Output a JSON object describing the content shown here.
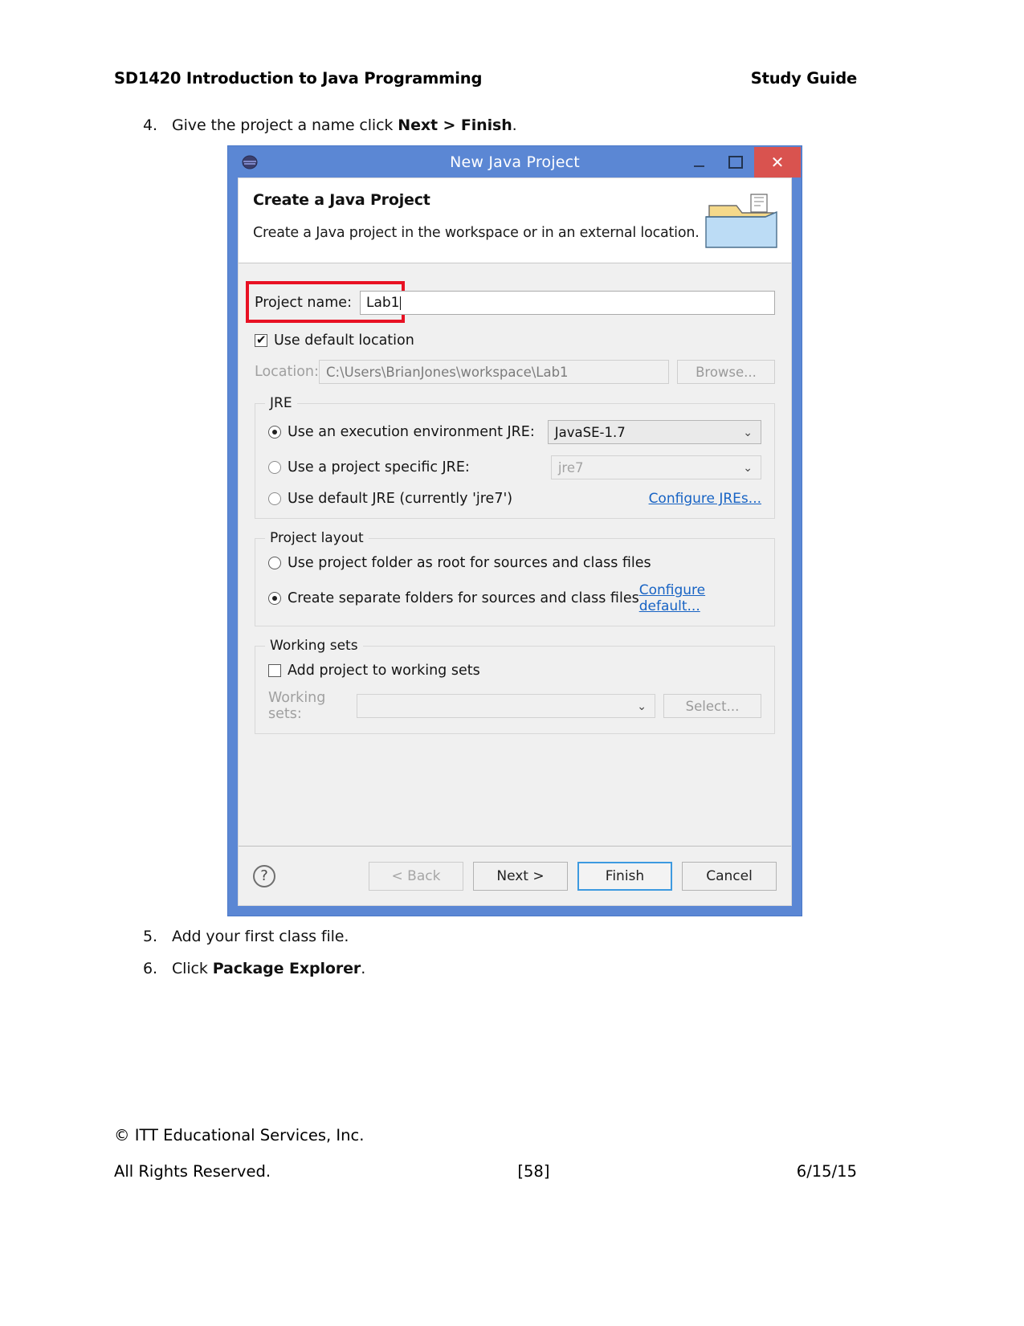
{
  "document": {
    "header_left": "SD1420 Introduction to Java Programming",
    "header_right": "Study Guide",
    "steps": [
      {
        "num": "4.",
        "pre": "Give the project a name click ",
        "bold": "Next > Finish",
        "post": "."
      },
      {
        "num": "5.",
        "pre": "Add your first class file.",
        "bold": "",
        "post": ""
      },
      {
        "num": "6.",
        "pre": "Click ",
        "bold": "Package Explorer",
        "post": "."
      }
    ],
    "footer": {
      "line1": "© ITT Educational Services, Inc.",
      "rights": "All Rights Reserved.",
      "page": "[58]",
      "date": "6/15/15"
    }
  },
  "dialog": {
    "title": "New Java Project",
    "app_icon": "eclipse-icon",
    "window_buttons": {
      "minimize": "–",
      "maximize": "▢",
      "close": "✕"
    },
    "banner": {
      "heading": "Create a Java Project",
      "subtext": "Create a Java project in the workspace or in an external location.",
      "image": "java-project-folder-icon"
    },
    "project_name": {
      "label": "Project name:",
      "value": "Lab1"
    },
    "use_default_location": {
      "label": "Use default location",
      "checked": true
    },
    "location": {
      "label": "Location:",
      "value": "C:\\Users\\BrianJones\\workspace\\Lab1",
      "browse_label": "Browse..."
    },
    "jre": {
      "legend": "JRE",
      "option_env": {
        "label": "Use an execution environment JRE:",
        "selected": true,
        "value": "JavaSE-1.7"
      },
      "option_specific": {
        "label": "Use a project specific JRE:",
        "selected": false,
        "value": "jre7"
      },
      "option_default": {
        "label": "Use default JRE (currently 'jre7')",
        "selected": false
      },
      "configure_link": "Configure JREs..."
    },
    "project_layout": {
      "legend": "Project layout",
      "option_root": {
        "label": "Use project folder as root for sources and class files",
        "selected": false
      },
      "option_separate": {
        "label": "Create separate folders for sources and class files",
        "selected": true
      },
      "configure_link": "Configure default..."
    },
    "working_sets": {
      "legend": "Working sets",
      "add_checkbox": {
        "label": "Add project to working sets",
        "checked": false
      },
      "label": "Working sets:",
      "value": "",
      "select_label": "Select..."
    },
    "buttons": {
      "help": "?",
      "back": "< Back",
      "next": "Next >",
      "finish": "Finish",
      "cancel": "Cancel"
    },
    "colors": {
      "titlebar": "#5b87d4",
      "close": "#d9534f",
      "highlight": "#e81123",
      "link": "#1763c4",
      "primary_border": "#3d9ae0"
    }
  }
}
